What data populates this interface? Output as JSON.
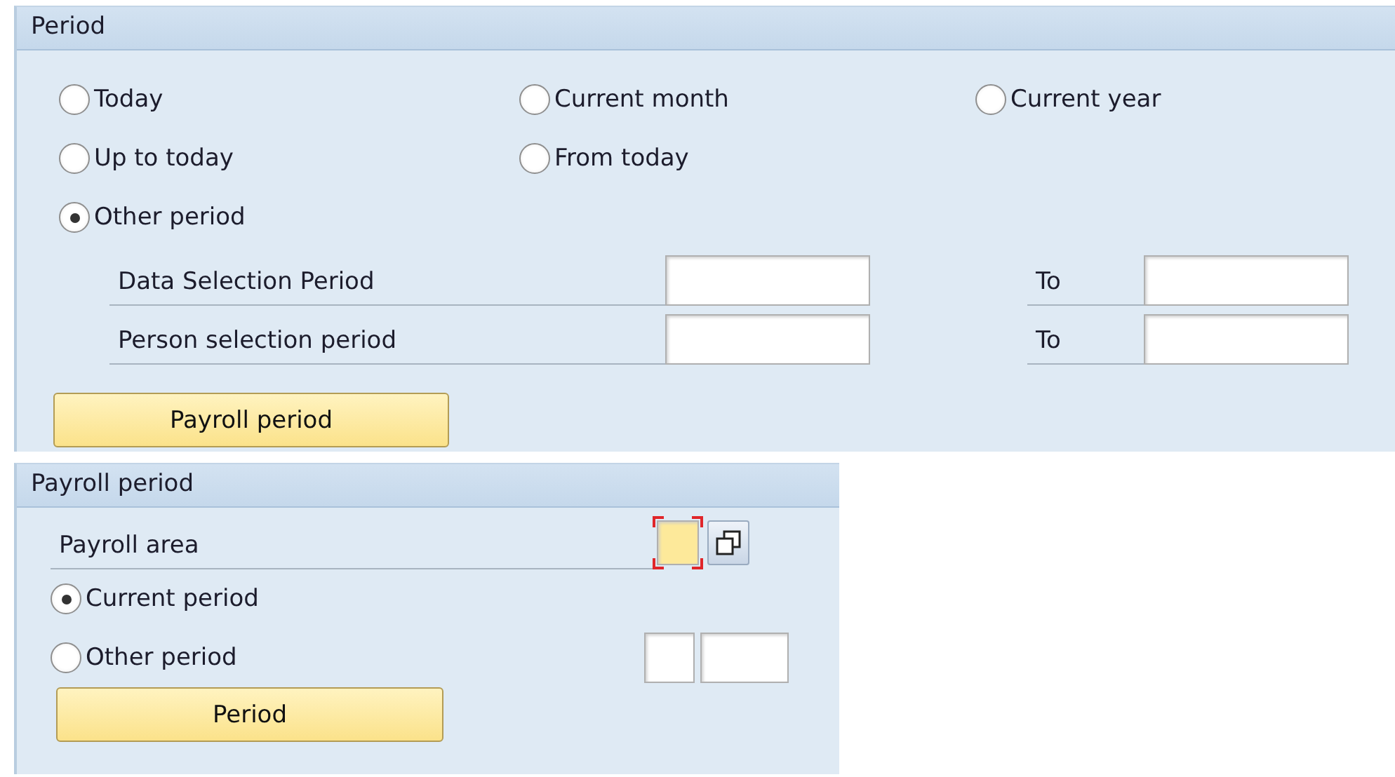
{
  "period": {
    "title": "Period",
    "option_rows": [
      [
        {
          "label": "Today",
          "selected": false
        },
        {
          "label": "Current month",
          "selected": false
        },
        {
          "label": "Current year",
          "selected": false
        }
      ],
      [
        {
          "label": "Up to today",
          "selected": false
        },
        {
          "label": "From today",
          "selected": false
        }
      ],
      [
        {
          "label": "Other period",
          "selected": true
        }
      ]
    ],
    "ranges": [
      {
        "label": "Data Selection Period",
        "to_label": "To"
      },
      {
        "label": "Person selection period",
        "to_label": "To"
      }
    ],
    "button": "Payroll period"
  },
  "payroll_period": {
    "title": "Payroll period",
    "area_label": "Payroll area",
    "area_required": true,
    "options": [
      {
        "label": "Current period",
        "selected": true
      },
      {
        "label": "Other period",
        "selected": false
      }
    ],
    "button": "Period"
  }
}
